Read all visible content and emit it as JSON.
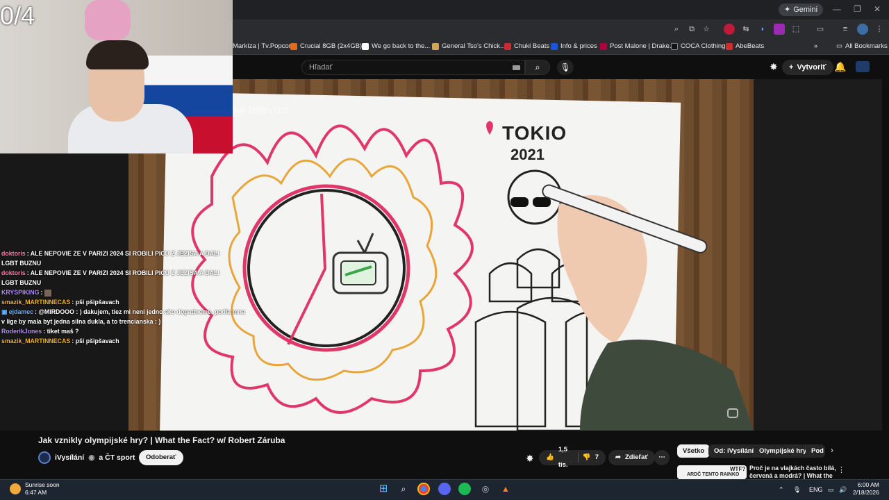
{
  "stream": {
    "counter": "0/4"
  },
  "browser": {
    "gemini_label": "Gemini",
    "bookmarks": [
      {
        "label": "Markíza | Tv.Popcor...",
        "color": "#333333"
      },
      {
        "label": "Crucial 8GB (2x4GB)...",
        "color": "#e06a1e"
      },
      {
        "label": "We go back to the...",
        "color": "#ffffff"
      },
      {
        "label": "General Tso's Chick...",
        "color": "#d4a35a"
      },
      {
        "label": "Chuki Beats",
        "color": "#cc2b2b"
      },
      {
        "label": "Info & prices",
        "color": "#1a56db"
      },
      {
        "label": "Post Malone | Drake...",
        "color": "#b3003c"
      },
      {
        "label": "COCA Clothing",
        "color": "#111111"
      },
      {
        "label": "AbeBeats",
        "color": "#d42b2b"
      }
    ],
    "all_bookmarks": "All Bookmarks"
  },
  "youtube": {
    "search_placeholder": "Hľadať",
    "create_label": "Vytvoriť",
    "video": {
      "title": "Jak vznikly olympijské hry? | What the Fact? w/ Robert Záruba",
      "drawing_text_city": "TOKIO",
      "drawing_text_year": "2021",
      "watermark": "ká televize"
    },
    "channel": {
      "name": "iVysílání",
      "collab": "a ČT sport",
      "subscribe_label": "Odoberať"
    },
    "likes": "1,5 tis.",
    "dislikes": "7",
    "share_label": "Zdieľať",
    "chips": [
      "Všetko",
      "Od: iVysílání",
      "Olympijské hry",
      "Pod"
    ],
    "recommendation": {
      "thumb_text": "ARDČ TENTO RAINKO",
      "thumb_badge": "WTF?",
      "title": "Proč je na vlajkách často bílá, červená a modrá? | What the"
    }
  },
  "chat": [
    {
      "user": "doktoris",
      "color": "#ff7fa8",
      "msg": "ALE NEPOVIE ZE V PARIZI 2024 SI ROBILI PICU Z JEZISA A DALI"
    },
    {
      "user": "",
      "color": "#ffffff",
      "msg": "LGBT BUZNU"
    },
    {
      "user": "doktoris",
      "color": "#ff7fa8",
      "msg": "ALE NEPOVIE ZE V PARIZI 2024 SI ROBILI PICU Z JEZISA A DALI"
    },
    {
      "user": "",
      "color": "#ffffff",
      "msg": "LGBT BUZNU"
    },
    {
      "user": "KRYSPIKING",
      "color": "#b08cff",
      "msg": ""
    },
    {
      "user": "smazik_MARTINNECAS",
      "color": "#f0b429",
      "msg": "pši pšipšavach"
    },
    {
      "user": "ejdamec",
      "color": "#5fb3ff",
      "msg": "@MIRDOOO : ) dakujem, tiez mi neni jedno ako dopadneme, podla mna"
    },
    {
      "user": "",
      "color": "#ffffff",
      "msg": "v lige by mala byt jedna silna dukla, a to trencianska : )"
    },
    {
      "user": "RoderikJones",
      "color": "#b08cff",
      "msg": "tiket maš ?"
    },
    {
      "user": "smazik_MARTINNECAS",
      "color": "#f0b429",
      "msg": "pši pšipšavach"
    }
  ],
  "taskbar": {
    "weather_title": "Sunrise soon",
    "weather_time": "6:47 AM",
    "lang": "ENG",
    "time": "6:00 AM",
    "date": "2/18/2026"
  }
}
